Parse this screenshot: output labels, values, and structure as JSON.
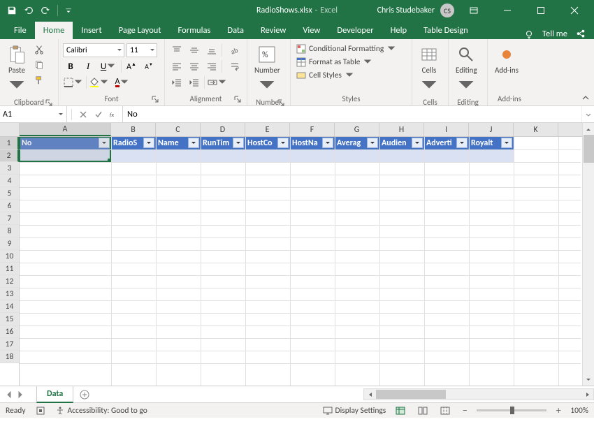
{
  "title": {
    "file": "RadioShows.xlsx",
    "app": "Excel"
  },
  "user": {
    "name": "Chris Studebaker",
    "initials": "CS"
  },
  "tabs": [
    "File",
    "Home",
    "Insert",
    "Page Layout",
    "Formulas",
    "Data",
    "Review",
    "View",
    "Developer",
    "Help",
    "Table Design"
  ],
  "active_tab": "Home",
  "tellme": "Tell me",
  "ribbon": {
    "clipboard": {
      "paste": "Paste",
      "label": "Clipboard"
    },
    "font": {
      "name": "Calibri",
      "size": "11",
      "label": "Font"
    },
    "alignment": {
      "label": "Alignment"
    },
    "number": {
      "btn": "Number",
      "label": "Number"
    },
    "styles": {
      "cond": "Conditional Formatting",
      "table": "Format as Table",
      "cell": "Cell Styles",
      "label": "Styles"
    },
    "cells": {
      "btn": "Cells",
      "label": "Cells"
    },
    "editing": {
      "btn": "Editing",
      "label": "Editing"
    },
    "addins": {
      "btn": "Add-ins",
      "label": "Add-ins"
    }
  },
  "name_box": "A1",
  "formula": "No",
  "columns": [
    "A",
    "B",
    "C",
    "D",
    "E",
    "F",
    "G",
    "H",
    "I",
    "J",
    "K"
  ],
  "table_headers": [
    "No",
    "RadioS",
    "Name",
    "RunTim",
    "HostCo",
    "HostNa",
    "Averag",
    "Audien",
    "Adverti",
    "Royalt"
  ],
  "sheet": {
    "active": "Data"
  },
  "status": {
    "mode": "Ready",
    "accessibility": "Accessibility: Good to go",
    "display": "Display Settings",
    "zoom": "100%"
  }
}
